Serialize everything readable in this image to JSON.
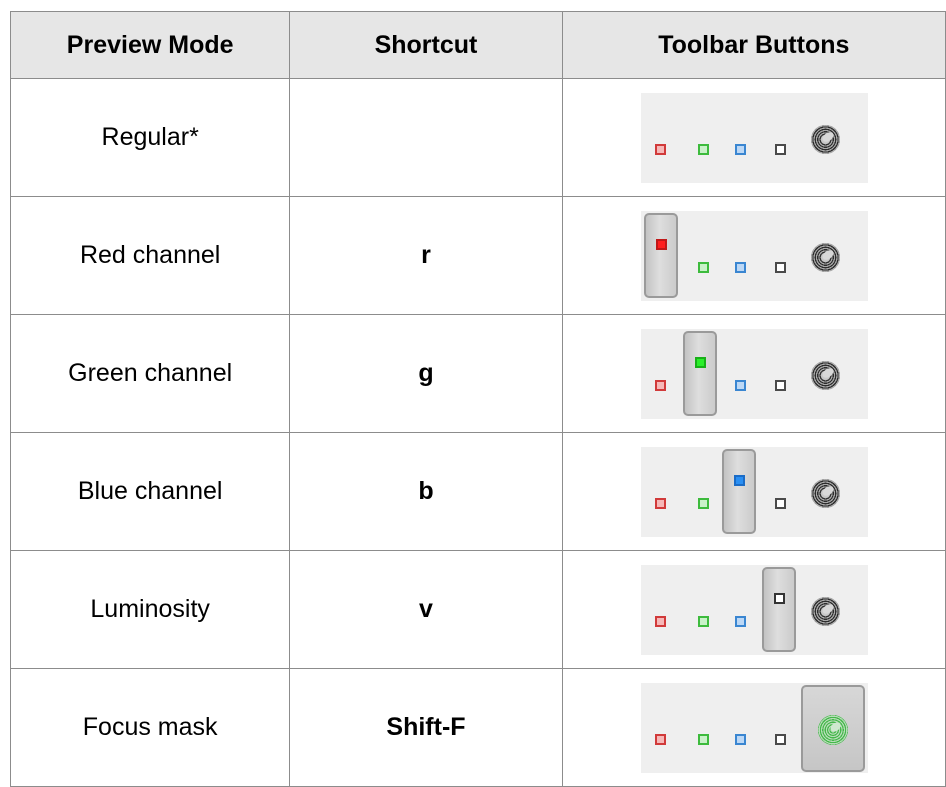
{
  "table": {
    "headers": [
      "Preview Mode",
      "Shortcut",
      "Toolbar Buttons"
    ],
    "rows": [
      {
        "mode": "Regular*",
        "shortcut": "",
        "active": "none"
      },
      {
        "mode": "Red channel",
        "shortcut": "r",
        "active": "red"
      },
      {
        "mode": "Green channel",
        "shortcut": "g",
        "active": "green"
      },
      {
        "mode": "Blue channel",
        "shortcut": "b",
        "active": "blue"
      },
      {
        "mode": "Luminosity",
        "shortcut": "v",
        "active": "luminosity"
      },
      {
        "mode": "Focus mask",
        "shortcut": "Shift-F",
        "active": "focus"
      }
    ]
  },
  "toolbar": {
    "buttons": [
      {
        "icon": "red-channel-icon",
        "color": "#ff1f1f"
      },
      {
        "icon": "green-channel-icon",
        "color": "#2aef2a"
      },
      {
        "icon": "blue-channel-icon",
        "color": "#2a8ff3"
      },
      {
        "icon": "luminosity-icon",
        "color": "#ffffff"
      },
      {
        "icon": "focus-mask-icon",
        "color": "#44b84a"
      }
    ]
  }
}
